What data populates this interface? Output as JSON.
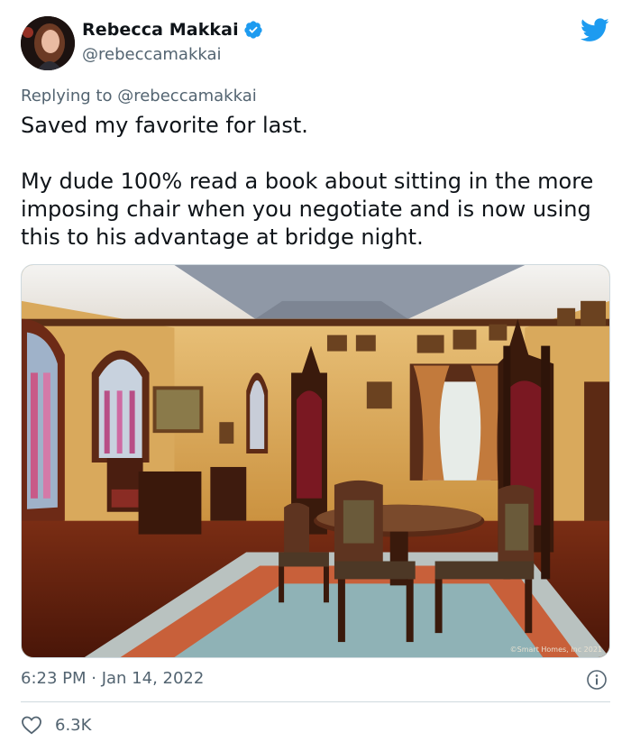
{
  "author": {
    "display_name": "Rebecca Makkai",
    "handle": "@rebeccamakkai",
    "verified": true,
    "avatar_icon": "avatar-photo"
  },
  "reply": {
    "prefix": "Replying to",
    "mention": "@rebeccamakkai"
  },
  "tweet": {
    "line1": "Saved my favorite for last.",
    "line2": "My dude 100% read a book about sitting in the more imposing chair when you negotiate and is now using this to his advantage at bridge night."
  },
  "media": {
    "watermark": "©Smart Homes, Inc 2021"
  },
  "meta": {
    "timestamp": "6:23 PM · Jan 14, 2022",
    "likes": "6.3K"
  },
  "colors": {
    "brand_blue": "#1d9bf0",
    "secondary_text": "#536471",
    "primary_text": "#0f1419"
  }
}
